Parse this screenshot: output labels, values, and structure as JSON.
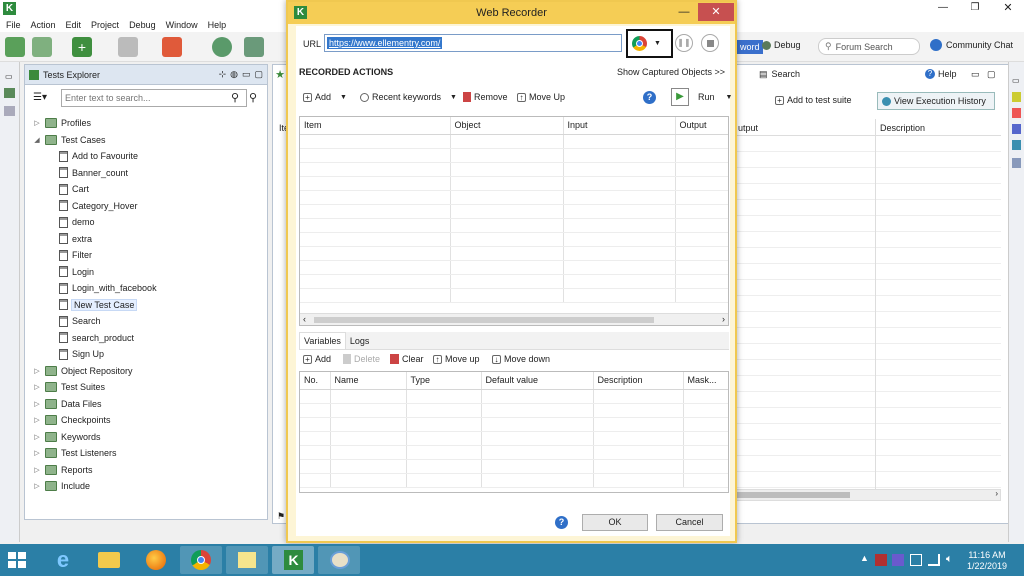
{
  "menu": [
    "File",
    "Action",
    "Edit",
    "Project",
    "Debug",
    "Window",
    "Help"
  ],
  "toolbar_right": {
    "keyword_tab": "word",
    "debug_tab": "Debug",
    "forum_search": "Forum Search",
    "community_chat": "Community Chat"
  },
  "explorer": {
    "title": "Tests Explorer",
    "filter_placeholder": "Enter text to search...",
    "tree": [
      {
        "label": "Profiles",
        "level": 0,
        "type": "folder",
        "expanded": false
      },
      {
        "label": "Test Cases",
        "level": 0,
        "type": "folder",
        "expanded": true
      },
      {
        "label": "Add to Favourite",
        "level": 1,
        "type": "case"
      },
      {
        "label": "Banner_count",
        "level": 1,
        "type": "case"
      },
      {
        "label": "Cart",
        "level": 1,
        "type": "case"
      },
      {
        "label": "Category_Hover",
        "level": 1,
        "type": "case"
      },
      {
        "label": "demo",
        "level": 1,
        "type": "case"
      },
      {
        "label": "extra",
        "level": 1,
        "type": "case"
      },
      {
        "label": "Filter",
        "level": 1,
        "type": "case"
      },
      {
        "label": "Login",
        "level": 1,
        "type": "case"
      },
      {
        "label": "Login_with_facebook",
        "level": 1,
        "type": "case"
      },
      {
        "label": "New Test Case",
        "level": 1,
        "type": "case",
        "selected": true
      },
      {
        "label": "Search",
        "level": 1,
        "type": "case"
      },
      {
        "label": "search_product",
        "level": 1,
        "type": "case"
      },
      {
        "label": "Sign Up",
        "level": 1,
        "type": "case"
      },
      {
        "label": "Object Repository",
        "level": 0,
        "type": "folder",
        "expanded": false
      },
      {
        "label": "Test Suites",
        "level": 0,
        "type": "folder",
        "expanded": false
      },
      {
        "label": "Data Files",
        "level": 0,
        "type": "folder",
        "expanded": false
      },
      {
        "label": "Checkpoints",
        "level": 0,
        "type": "folder",
        "expanded": false
      },
      {
        "label": "Keywords",
        "level": 0,
        "type": "folder",
        "expanded": false
      },
      {
        "label": "Test Listeners",
        "level": 0,
        "type": "folder",
        "expanded": false
      },
      {
        "label": "Reports",
        "level": 0,
        "type": "folder",
        "expanded": false
      },
      {
        "label": "Include",
        "level": 0,
        "type": "folder",
        "expanded": false
      }
    ]
  },
  "right_panel": {
    "search_tab": "Search",
    "help_tab": "Help",
    "add_to_suite": "Add to test suite",
    "view_history": "View Execution History",
    "col_item_partial": "Ite",
    "col_output": "utput",
    "col_description": "Description"
  },
  "recorder": {
    "title": "Web Recorder",
    "url_label": "URL",
    "url_value": "https://www.ellementry.com/",
    "recorded_actions": "RECORDED ACTIONS",
    "show_captured": "Show Captured Objects >>",
    "add": "Add",
    "recent_keywords": "Recent keywords",
    "remove": "Remove",
    "move_up": "Move Up",
    "run": "Run",
    "action_columns": [
      "Item",
      "Object",
      "Input",
      "Output"
    ],
    "tabs": [
      "Variables",
      "Logs"
    ],
    "var_add": "Add",
    "var_delete": "Delete",
    "var_clear": "Clear",
    "var_move_up": "Move up",
    "var_move_down": "Move down",
    "var_columns": [
      "No.",
      "Name",
      "Type",
      "Default value",
      "Description",
      "Mask..."
    ],
    "ok": "OK",
    "cancel": "Cancel"
  },
  "taskbar": {
    "time": "11:16 AM",
    "date": "1/22/2019"
  },
  "colors": {
    "dialog_title": "#f5cd55",
    "dialog_border": "#f0c850",
    "taskbar": "#2b7fa6",
    "url_highlight": "#3377cc"
  }
}
